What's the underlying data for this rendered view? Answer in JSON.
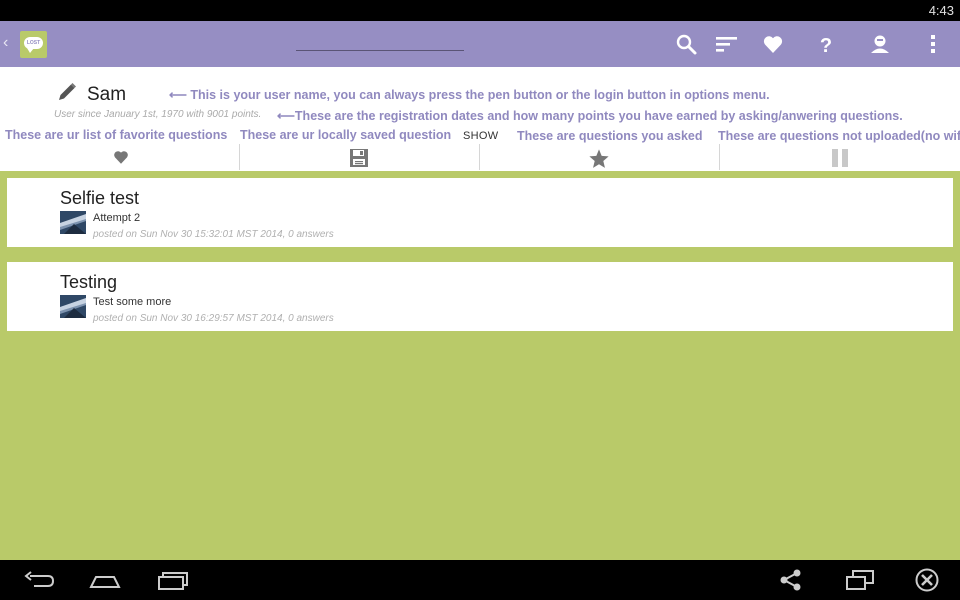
{
  "status_bar": {
    "time": "4:43"
  },
  "action_bar": {
    "app_icon_text": "LOST",
    "search_placeholder": "",
    "icons": [
      "search-icon",
      "sort-icon",
      "heart-icon",
      "help-icon",
      "login-icon",
      "overflow-icon"
    ]
  },
  "profile": {
    "username": "Sam",
    "since_text": "User since January 1st, 1970 with 9001 points.",
    "show_label": "SHOW",
    "tutorial": {
      "username_note": "⟵ This is your user name, you can always press the pen button or the login button in options menu.",
      "registration_note": "⟵These are the registration dates and how many points you have earned by asking/anwering questions.",
      "favorites_note": "These are ur list of favorite questions",
      "saved_note": "These are ur locally saved question",
      "asked_note": "These are questions you asked",
      "pending_note": "These are questions not uploaded(no wifi)"
    }
  },
  "tabs": [
    {
      "name": "favorites",
      "icon": "heart-icon"
    },
    {
      "name": "saved",
      "icon": "save-icon"
    },
    {
      "name": "asked",
      "icon": "star-icon"
    },
    {
      "name": "pending",
      "icon": "pause-icon"
    }
  ],
  "questions": [
    {
      "title": "Selfie test",
      "body": "Attempt 2",
      "meta": "posted on Sun Nov 30 15:32:01 MST 2014, 0 answers"
    },
    {
      "title": "Testing",
      "body": "Test some more",
      "meta": "posted on Sun Nov 30 16:29:57 MST 2014, 0 answers"
    }
  ],
  "colors": {
    "action_bar": "#968ec3",
    "background": "#b9ca69",
    "tutorial_text": "#9089bf"
  }
}
